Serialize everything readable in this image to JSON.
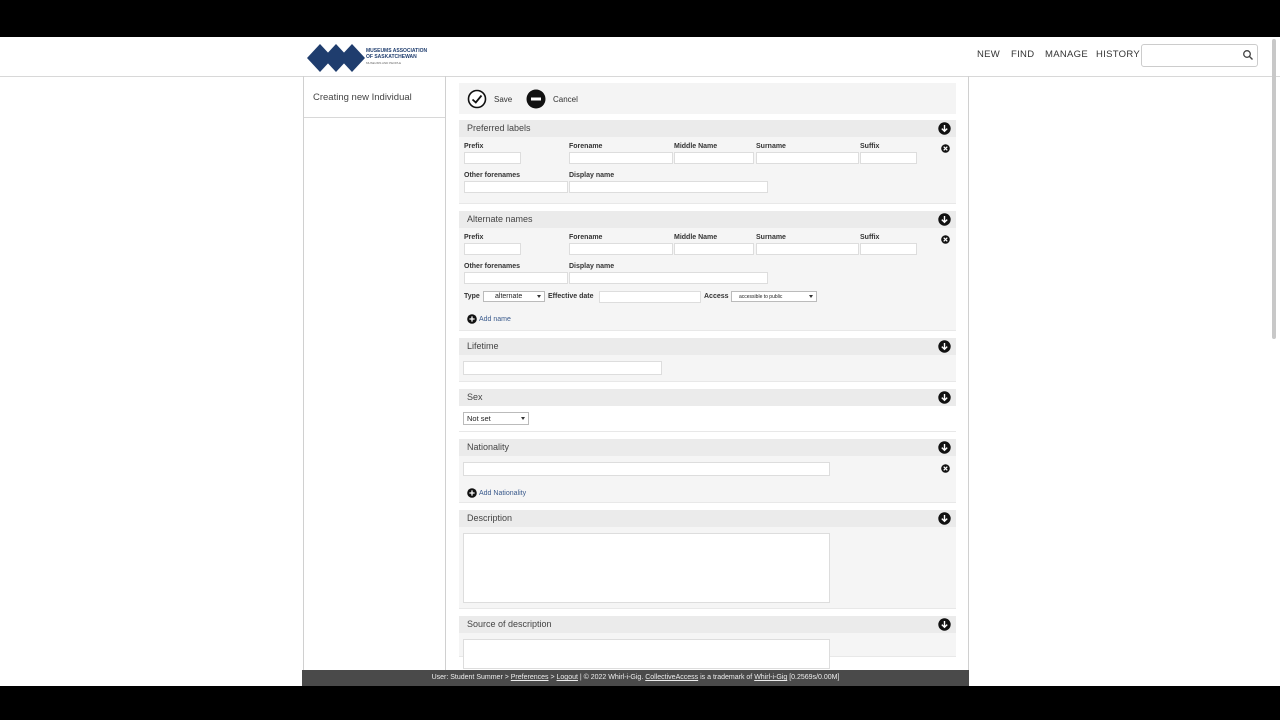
{
  "nav": {
    "new": "NEW",
    "find": "FIND",
    "manage": "MANAGE",
    "history": "HISTORY"
  },
  "logo": {
    "line1": "MUSEUMS ASSOCIATION",
    "line2": "OF SASKATCHEWAN",
    "tagline": "MUSEUMS AND PEOPLE"
  },
  "search": {
    "placeholder": "",
    "value": ""
  },
  "sidebar": {
    "title": "Creating new Individual"
  },
  "actions": {
    "save": "Save",
    "cancel": "Cancel"
  },
  "preferred": {
    "title": "Preferred labels",
    "prefix": "Prefix",
    "forename": "Forename",
    "middle": "Middle Name",
    "surname": "Surname",
    "suffix": "Suffix",
    "other": "Other forenames",
    "display": "Display name"
  },
  "alternate": {
    "title": "Alternate names",
    "prefix": "Prefix",
    "forename": "Forename",
    "middle": "Middle Name",
    "surname": "Surname",
    "suffix": "Suffix",
    "other": "Other forenames",
    "display": "Display name",
    "type_label": "Type",
    "type_value": "alternate",
    "date_label": "Effective date",
    "access_label": "Access",
    "access_value": "accessible to public",
    "add": "Add name"
  },
  "lifetime": {
    "title": "Lifetime"
  },
  "sex": {
    "title": "Sex",
    "value": "Not set"
  },
  "nationality": {
    "title": "Nationality",
    "add": "Add Nationality"
  },
  "description": {
    "title": "Description"
  },
  "source": {
    "title": "Source of description"
  },
  "footer": {
    "user": "User: Student Summer >",
    "preferences": "Preferences",
    "sep1": ">",
    "logout": "Logout",
    "copy": "| © 2022 Whirl-i-Gig.",
    "ca": "CollectiveAccess",
    "tm": "is a trademark of",
    "wig": "Whirl-i-Gig",
    "stats": "[0.2569s/0.00M]"
  },
  "colors": {
    "accent": "#1f3d6e",
    "footer_bg": "#4a4a4a"
  }
}
